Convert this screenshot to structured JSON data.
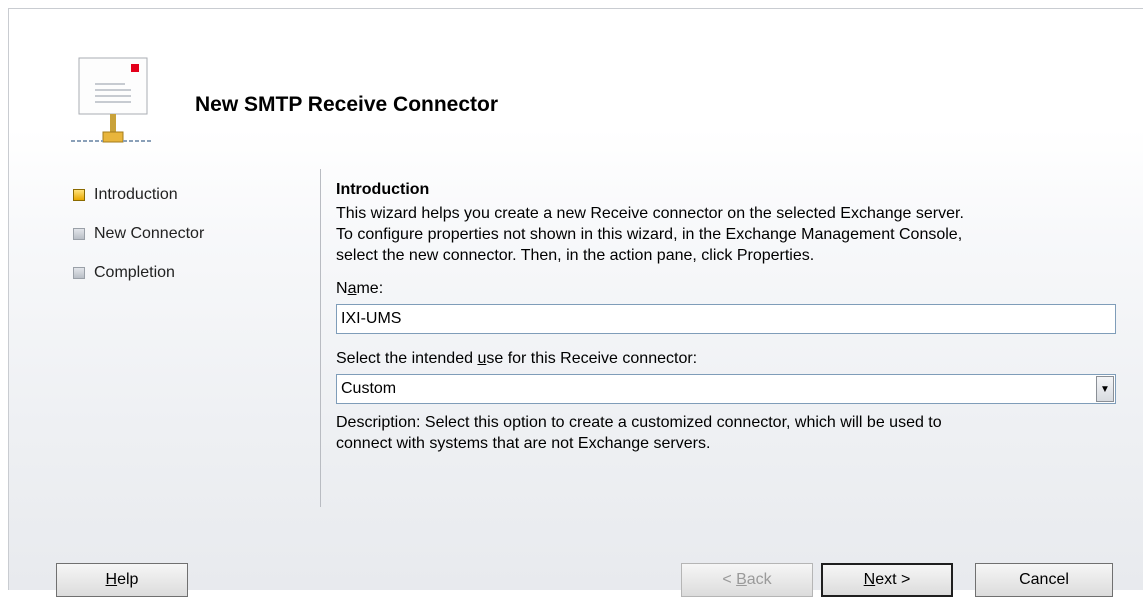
{
  "wizard": {
    "title": "New SMTP Receive Connector"
  },
  "steps": [
    {
      "label": "Introduction",
      "state": "current"
    },
    {
      "label": "New Connector",
      "state": "pending"
    },
    {
      "label": "Completion",
      "state": "pending"
    }
  ],
  "intro": {
    "heading": "Introduction",
    "lines": [
      "This wizard helps you create a new Receive connector on the selected Exchange server.",
      "To configure properties not shown in this wizard, in the Exchange Management Console,",
      "select the new connector. Then, in the action pane, click Properties."
    ]
  },
  "name_field": {
    "label_pre": "N",
    "label_access": "a",
    "label_post": "me:",
    "value": "IXI-UMS"
  },
  "use_field": {
    "label_pre": "Select the intended ",
    "label_access": "u",
    "label_post": "se for this Receive connector:",
    "selected": "Custom"
  },
  "description": {
    "lines": [
      "Description: Select this option to create a customized connector, which will be used to",
      "connect with systems that are not Exchange servers."
    ]
  },
  "buttons": {
    "help": {
      "access": "H",
      "rest": "elp"
    },
    "back": {
      "pre": "< ",
      "access": "B",
      "rest": "ack"
    },
    "next": {
      "access": "N",
      "rest": "ext >"
    },
    "cancel": "Cancel"
  },
  "colors": {
    "active_step": "#e8a800",
    "pending_step": "#b9bec6",
    "input_border": "#7f9db9"
  }
}
